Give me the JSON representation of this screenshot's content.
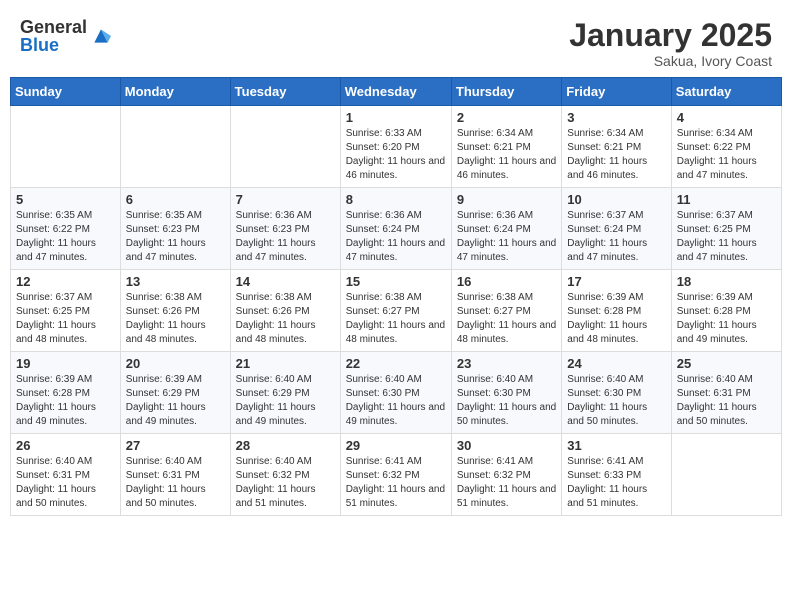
{
  "header": {
    "logo_general": "General",
    "logo_blue": "Blue",
    "month": "January 2025",
    "location": "Sakua, Ivory Coast"
  },
  "days_of_week": [
    "Sunday",
    "Monday",
    "Tuesday",
    "Wednesday",
    "Thursday",
    "Friday",
    "Saturday"
  ],
  "weeks": [
    [
      {
        "day": "",
        "info": ""
      },
      {
        "day": "",
        "info": ""
      },
      {
        "day": "",
        "info": ""
      },
      {
        "day": "1",
        "info": "Sunrise: 6:33 AM\nSunset: 6:20 PM\nDaylight: 11 hours and 46 minutes."
      },
      {
        "day": "2",
        "info": "Sunrise: 6:34 AM\nSunset: 6:21 PM\nDaylight: 11 hours and 46 minutes."
      },
      {
        "day": "3",
        "info": "Sunrise: 6:34 AM\nSunset: 6:21 PM\nDaylight: 11 hours and 46 minutes."
      },
      {
        "day": "4",
        "info": "Sunrise: 6:34 AM\nSunset: 6:22 PM\nDaylight: 11 hours and 47 minutes."
      }
    ],
    [
      {
        "day": "5",
        "info": "Sunrise: 6:35 AM\nSunset: 6:22 PM\nDaylight: 11 hours and 47 minutes."
      },
      {
        "day": "6",
        "info": "Sunrise: 6:35 AM\nSunset: 6:23 PM\nDaylight: 11 hours and 47 minutes."
      },
      {
        "day": "7",
        "info": "Sunrise: 6:36 AM\nSunset: 6:23 PM\nDaylight: 11 hours and 47 minutes."
      },
      {
        "day": "8",
        "info": "Sunrise: 6:36 AM\nSunset: 6:24 PM\nDaylight: 11 hours and 47 minutes."
      },
      {
        "day": "9",
        "info": "Sunrise: 6:36 AM\nSunset: 6:24 PM\nDaylight: 11 hours and 47 minutes."
      },
      {
        "day": "10",
        "info": "Sunrise: 6:37 AM\nSunset: 6:24 PM\nDaylight: 11 hours and 47 minutes."
      },
      {
        "day": "11",
        "info": "Sunrise: 6:37 AM\nSunset: 6:25 PM\nDaylight: 11 hours and 47 minutes."
      }
    ],
    [
      {
        "day": "12",
        "info": "Sunrise: 6:37 AM\nSunset: 6:25 PM\nDaylight: 11 hours and 48 minutes."
      },
      {
        "day": "13",
        "info": "Sunrise: 6:38 AM\nSunset: 6:26 PM\nDaylight: 11 hours and 48 minutes."
      },
      {
        "day": "14",
        "info": "Sunrise: 6:38 AM\nSunset: 6:26 PM\nDaylight: 11 hours and 48 minutes."
      },
      {
        "day": "15",
        "info": "Sunrise: 6:38 AM\nSunset: 6:27 PM\nDaylight: 11 hours and 48 minutes."
      },
      {
        "day": "16",
        "info": "Sunrise: 6:38 AM\nSunset: 6:27 PM\nDaylight: 11 hours and 48 minutes."
      },
      {
        "day": "17",
        "info": "Sunrise: 6:39 AM\nSunset: 6:28 PM\nDaylight: 11 hours and 48 minutes."
      },
      {
        "day": "18",
        "info": "Sunrise: 6:39 AM\nSunset: 6:28 PM\nDaylight: 11 hours and 49 minutes."
      }
    ],
    [
      {
        "day": "19",
        "info": "Sunrise: 6:39 AM\nSunset: 6:28 PM\nDaylight: 11 hours and 49 minutes."
      },
      {
        "day": "20",
        "info": "Sunrise: 6:39 AM\nSunset: 6:29 PM\nDaylight: 11 hours and 49 minutes."
      },
      {
        "day": "21",
        "info": "Sunrise: 6:40 AM\nSunset: 6:29 PM\nDaylight: 11 hours and 49 minutes."
      },
      {
        "day": "22",
        "info": "Sunrise: 6:40 AM\nSunset: 6:30 PM\nDaylight: 11 hours and 49 minutes."
      },
      {
        "day": "23",
        "info": "Sunrise: 6:40 AM\nSunset: 6:30 PM\nDaylight: 11 hours and 50 minutes."
      },
      {
        "day": "24",
        "info": "Sunrise: 6:40 AM\nSunset: 6:30 PM\nDaylight: 11 hours and 50 minutes."
      },
      {
        "day": "25",
        "info": "Sunrise: 6:40 AM\nSunset: 6:31 PM\nDaylight: 11 hours and 50 minutes."
      }
    ],
    [
      {
        "day": "26",
        "info": "Sunrise: 6:40 AM\nSunset: 6:31 PM\nDaylight: 11 hours and 50 minutes."
      },
      {
        "day": "27",
        "info": "Sunrise: 6:40 AM\nSunset: 6:31 PM\nDaylight: 11 hours and 50 minutes."
      },
      {
        "day": "28",
        "info": "Sunrise: 6:40 AM\nSunset: 6:32 PM\nDaylight: 11 hours and 51 minutes."
      },
      {
        "day": "29",
        "info": "Sunrise: 6:41 AM\nSunset: 6:32 PM\nDaylight: 11 hours and 51 minutes."
      },
      {
        "day": "30",
        "info": "Sunrise: 6:41 AM\nSunset: 6:32 PM\nDaylight: 11 hours and 51 minutes."
      },
      {
        "day": "31",
        "info": "Sunrise: 6:41 AM\nSunset: 6:33 PM\nDaylight: 11 hours and 51 minutes."
      },
      {
        "day": "",
        "info": ""
      }
    ]
  ]
}
